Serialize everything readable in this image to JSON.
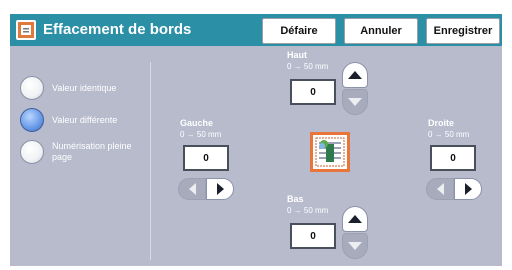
{
  "header": {
    "title": "Effacement de bords",
    "buttons": {
      "undo": "Défaire",
      "cancel": "Annuler",
      "save": "Enregistrer"
    }
  },
  "options": {
    "items": [
      {
        "label": "Valeur identique",
        "selected": false
      },
      {
        "label": "Valeur différente",
        "selected": true
      },
      {
        "label": "Numérisation pleine page",
        "selected": false
      }
    ]
  },
  "edges": {
    "top": {
      "label": "Haut",
      "range": "0 → 50 mm",
      "value": "0"
    },
    "left": {
      "label": "Gauche",
      "range": "0 → 50 mm",
      "value": "0"
    },
    "right": {
      "label": "Droite",
      "range": "0 → 50 mm",
      "value": "0"
    },
    "bottom": {
      "label": "Bas",
      "range": "0 → 50 mm",
      "value": "0"
    }
  },
  "colors": {
    "header_bg": "#2b8fa6",
    "panel_bg": "#b7bbcc",
    "selected_radio": "#5b8ad8"
  },
  "icons": {
    "title": "edge-erase-icon",
    "preview": "document-preview-icon"
  }
}
